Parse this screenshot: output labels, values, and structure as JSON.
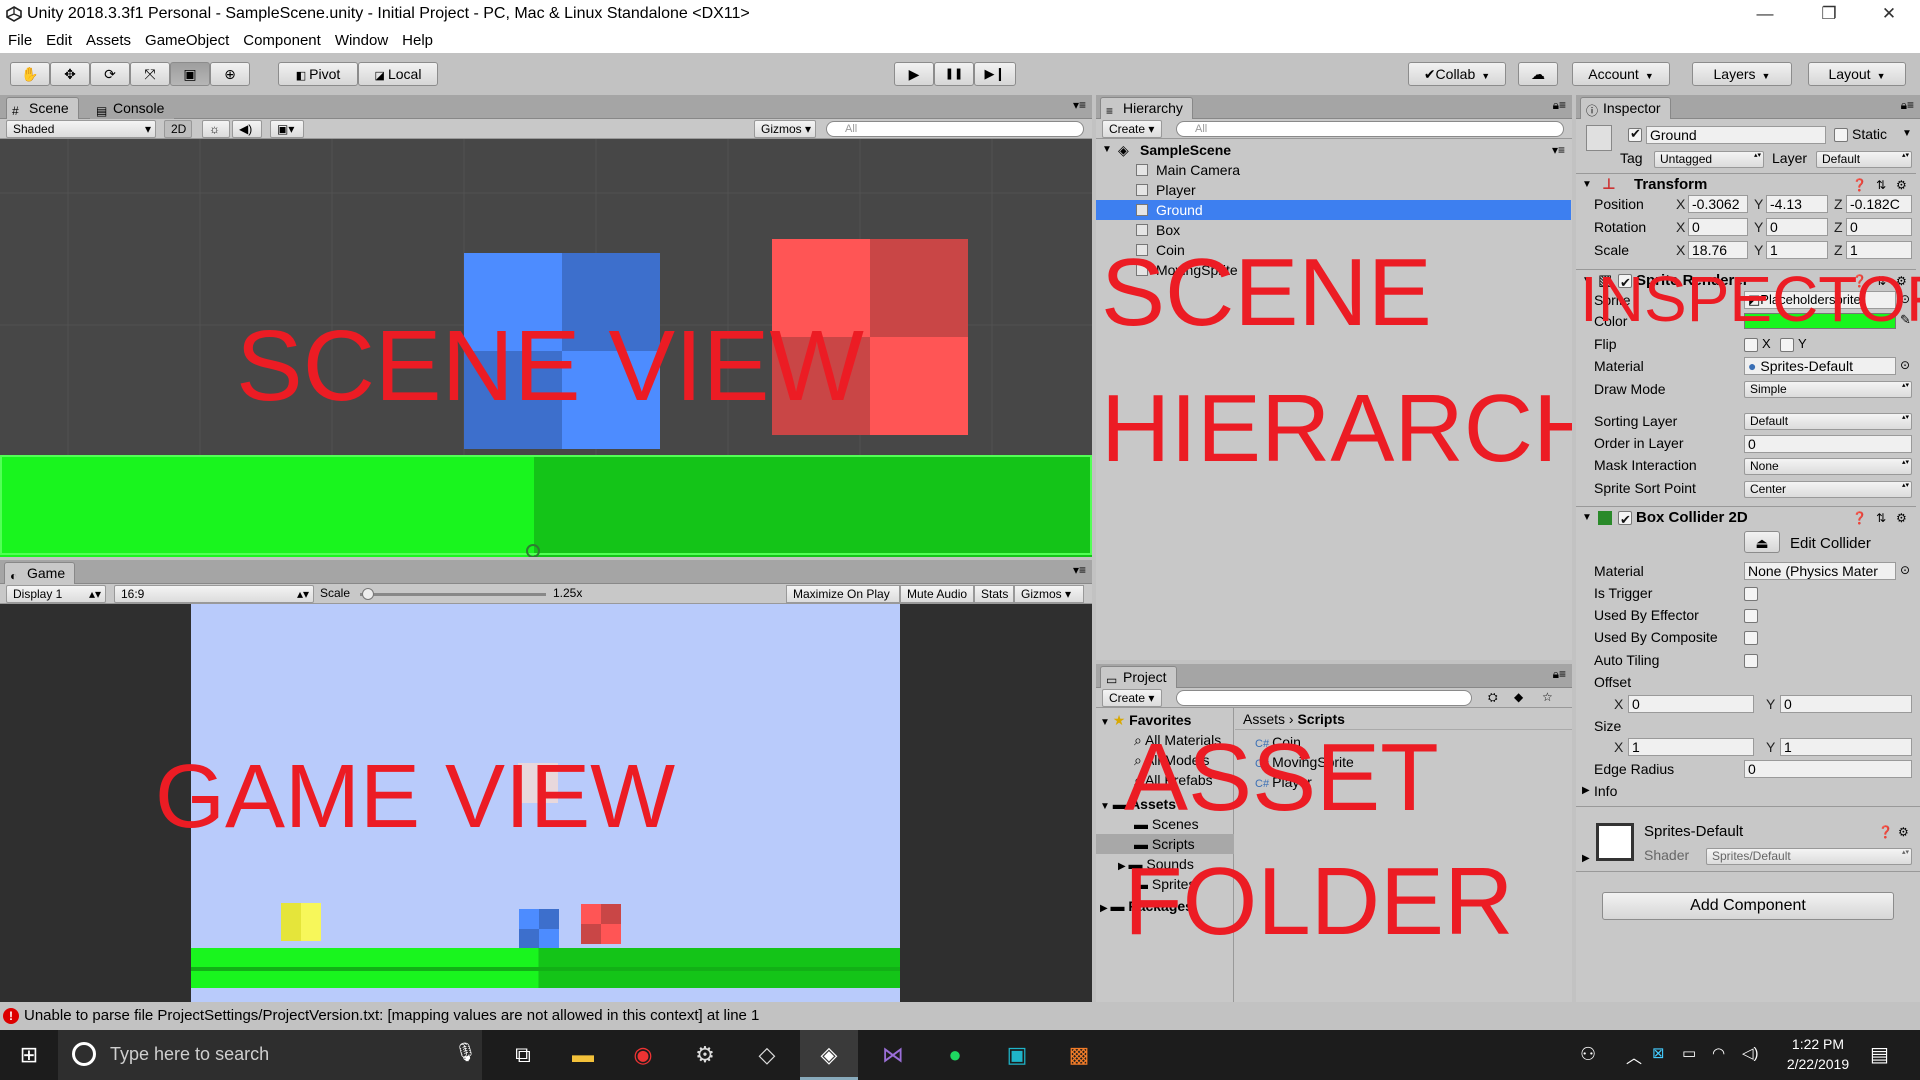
{
  "window": {
    "title": "Unity 2018.3.3f1 Personal - SampleScene.unity - Initial Project - PC, Mac & Linux Standalone <DX11>",
    "controls": {
      "minimize": "—",
      "restore": "❐",
      "close": "✕"
    }
  },
  "menubar": [
    "File",
    "Edit",
    "Assets",
    "GameObject",
    "Component",
    "Window",
    "Help"
  ],
  "toolbar": {
    "tools": [
      "hand-tool",
      "move-tool",
      "rotate-tool",
      "scale-tool",
      "rect-tool",
      "transform-tool"
    ],
    "pivot": "Pivot",
    "local": "Local",
    "play": "▶",
    "pause": "❚❚",
    "step": "▶❙",
    "collab": "Collab",
    "account": "Account",
    "layers": "Layers",
    "layout": "Layout"
  },
  "scene_panel": {
    "tabs": [
      "Scene",
      "Console"
    ],
    "shading": "Shaded",
    "mode_2d": "2D",
    "gizmos": "Gizmos",
    "search_placeholder": "All",
    "overlay": "SCENE VIEW"
  },
  "game_panel": {
    "tab": "Game",
    "display": "Display 1",
    "aspect": "16:9",
    "scale_label": "Scale",
    "scale_value": "1.25x",
    "scale_fraction": 0.01,
    "maximize": "Maximize On Play",
    "mute": "Mute Audio",
    "stats": "Stats",
    "gizmos": "Gizmos",
    "overlay": "GAME VIEW"
  },
  "hierarchy": {
    "tab": "Hierarchy",
    "create": "Create",
    "search_placeholder": "All",
    "scene": "SampleScene",
    "items": [
      "Main Camera",
      "Player",
      "Ground",
      "Box",
      "Coin",
      "MovingSprite"
    ],
    "selected": "Ground",
    "overlay_line1": "SCENE",
    "overlay_line2": "HIERARCHY"
  },
  "project": {
    "tab": "Project",
    "create": "Create",
    "favorites_label": "Favorites",
    "favorites": [
      "All Materials",
      "All Models",
      "All Prefabs"
    ],
    "assets_label": "Assets",
    "assets": [
      "Scenes",
      "Scripts",
      "Sounds",
      "Sprites"
    ],
    "packages_label": "Packages",
    "breadcrumb": [
      "Assets",
      "Scripts"
    ],
    "files": [
      "Coin",
      "MovingSprite",
      "Player"
    ],
    "overlay_line1": "ASSET",
    "overlay_line2": "FOLDER"
  },
  "inspector": {
    "tab": "Inspector",
    "object_name": "Ground",
    "static_label": "Static",
    "tag_label": "Tag",
    "tag_value": "Untagged",
    "layer_label": "Layer",
    "layer_value": "Default",
    "transform": {
      "title": "Transform",
      "position_label": "Position",
      "rotation_label": "Rotation",
      "scale_label": "Scale",
      "position": [
        "-0.3062",
        "-4.13",
        "-0.182C"
      ],
      "rotation": [
        "0",
        "0",
        "0"
      ],
      "scale": [
        "18.76",
        "1",
        "1"
      ]
    },
    "sprite_renderer": {
      "title": "Sprite Renderer",
      "sprite_label": "Sprite",
      "sprite_value": "Placeholdersprite",
      "color_label": "Color",
      "color_value": "#19f51e",
      "flip_label": "Flip",
      "material_label": "Material",
      "material_value": "Sprites-Default",
      "draw_mode_label": "Draw Mode",
      "draw_mode_value": "Simple",
      "sorting_layer_label": "Sorting Layer",
      "sorting_layer_value": "Default",
      "order_label": "Order in Layer",
      "order_value": "0",
      "mask_label": "Mask Interaction",
      "mask_value": "None",
      "sort_point_label": "Sprite Sort Point",
      "sort_point_value": "Center"
    },
    "box_collider": {
      "title": "Box Collider 2D",
      "edit_collider": "Edit Collider",
      "material_label": "Material",
      "material_value": "None (Physics Mater",
      "trigger_label": "Is Trigger",
      "effector_label": "Used By Effector",
      "composite_label": "Used By Composite",
      "tiling_label": "Auto Tiling",
      "offset_label": "Offset",
      "offset": [
        "0",
        "0"
      ],
      "size_label": "Size",
      "size": [
        "1",
        "1"
      ],
      "edge_label": "Edge Radius",
      "edge_value": "0",
      "info_label": "Info"
    },
    "material": {
      "name": "Sprites-Default",
      "shader_label": "Shader",
      "shader_value": "Sprites/Default"
    },
    "add_component": "Add Component",
    "overlay": "INSPECTOR"
  },
  "statusbar": {
    "message": "Unable to parse file ProjectSettings/ProjectVersion.txt: [mapping values are not allowed in this context] at line 1"
  },
  "taskbar": {
    "search_placeholder": "Type here to search",
    "time": "1:22 PM",
    "date": "2/22/2019"
  },
  "colors": {
    "selection": "#3d7ff0",
    "overlay_red": "#ec1c24",
    "ground_green": "#19f51e",
    "player_blue": "#4d8cff",
    "box_red": "#ff5555"
  }
}
